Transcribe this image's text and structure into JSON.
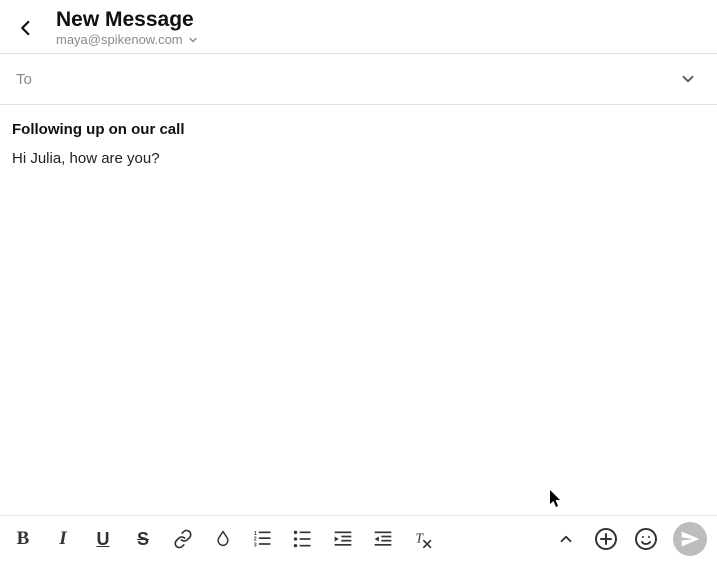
{
  "header": {
    "title": "New Message",
    "from_email": "maya@spikenow.com"
  },
  "to": {
    "label": "To",
    "value": ""
  },
  "compose": {
    "subject": "Following up on our call",
    "body": "Hi Julia, how are you?"
  },
  "icons": {
    "back": "back",
    "from_dropdown": "chevron-down",
    "to_expand": "chevron-down",
    "collapse": "chevron-up",
    "add": "plus-circle",
    "emoji": "smiley",
    "send": "paper-plane"
  }
}
